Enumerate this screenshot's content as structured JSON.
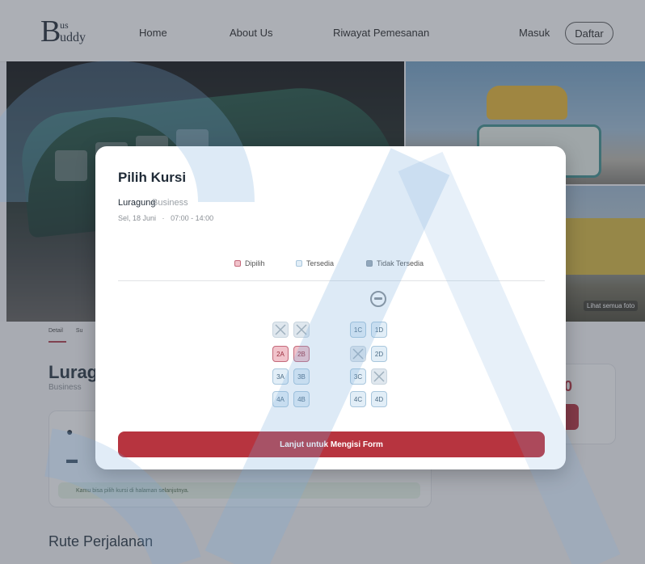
{
  "navbar": {
    "logo_big": "B",
    "logo_line1": "us",
    "logo_line2": "uddy",
    "links": [
      "Home",
      "About Us",
      "Riwayat Pemesanan"
    ],
    "login_label": "Masuk",
    "register_label": "Daftar"
  },
  "hero": {
    "see_all_label": "Lihat semua foto"
  },
  "page": {
    "tabs": [
      "Detail",
      "Su"
    ],
    "route_title": "Luragu",
    "class_label": "Business",
    "price_fragment": "0",
    "hint_text": "Kamu bisa pilih kursi di halaman selanjutnya.",
    "route_section_title": "Rute Perjalanan"
  },
  "modal": {
    "title": "Pilih Kursi",
    "route": "Luragung",
    "class": "Business",
    "date": "Sel, 18 Juni",
    "time": "07:00 - 14:00",
    "legend": {
      "selected": "Dipilih",
      "available": "Tersedia",
      "unavailable": "Tidak Tersedia"
    },
    "cta_label": "Lanjut untuk Mengisi Form"
  },
  "seats": {
    "left": [
      {
        "label": "",
        "state": "na"
      },
      {
        "label": "",
        "state": "na"
      },
      {
        "label": "2A",
        "state": "sel"
      },
      {
        "label": "2B",
        "state": "sel"
      },
      {
        "label": "3A",
        "state": "avail"
      },
      {
        "label": "3B",
        "state": "avail"
      },
      {
        "label": "4A",
        "state": "avail"
      },
      {
        "label": "4B",
        "state": "avail"
      }
    ],
    "right": [
      {
        "label": "1C",
        "state": "avail"
      },
      {
        "label": "1D",
        "state": "avail"
      },
      {
        "label": "",
        "state": "na"
      },
      {
        "label": "2D",
        "state": "avail"
      },
      {
        "label": "3C",
        "state": "avail"
      },
      {
        "label": "",
        "state": "na"
      },
      {
        "label": "4C",
        "state": "avail"
      },
      {
        "label": "4D",
        "state": "avail"
      }
    ]
  },
  "colors": {
    "accent": "#b7343f",
    "selected_seat": "#f1c3cb",
    "available_seat": "#e2eef7",
    "unavailable_seat": "#dfe7ee"
  }
}
